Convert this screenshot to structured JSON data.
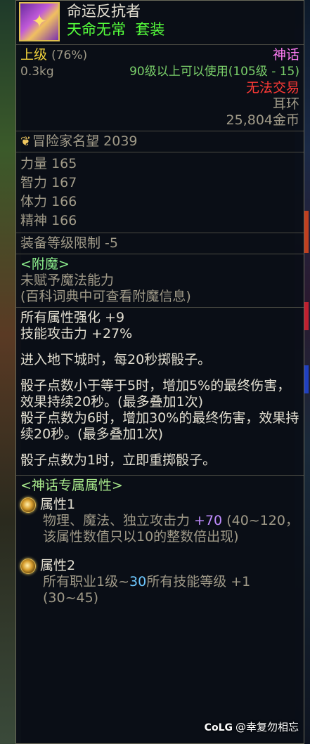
{
  "item": {
    "icon_name": "mythic-earring-icon",
    "name": "命运反抗者",
    "set_name": "天命无常",
    "set_label": "套装",
    "grade": "上级",
    "grade_pct": "(76%)",
    "rarity": "神话",
    "weight": "0.3kg",
    "level_req": "90级以上可以使用(105级 - 15)",
    "trade": "无法交易",
    "slot": "耳环",
    "price": "25,804金币"
  },
  "fame": {
    "icon_name": "laurel-icon",
    "label": "冒险家名望",
    "value": "2039"
  },
  "stats": [
    {
      "label": "力量",
      "value": "165"
    },
    {
      "label": "智力",
      "value": "167"
    },
    {
      "label": "体力",
      "value": "166"
    },
    {
      "label": "精神",
      "value": "166"
    }
  ],
  "equip_limit": "装备等级限制 -5",
  "enchant": {
    "title": "<附魔>",
    "line1": "未赋予魔法能力",
    "line2": "(百科词典中可查看附魔信息)"
  },
  "bonus": {
    "line1": "所有属性强化 +9",
    "line2": "技能攻击力 +27%"
  },
  "effect": {
    "p1": "进入地下城时，每20秒掷骰子。",
    "p2": "骰子点数小于等于5时，增加5%的最终伤害，效果持续20秒。(最多叠加1次)",
    "p3": "骰子点数为6时，增加30%的最终伤害，效果持续20秒。(最多叠加1次)",
    "p4": "骰子点数为1时，立即重掷骰子。"
  },
  "mythic": {
    "title": "<神话专属属性>",
    "attr1_label": "属性1",
    "attr1_pre": "物理、魔法、独立攻击力 ",
    "attr1_val": "+70",
    "attr1_post": " (40~120，该属性数值只以10的整数倍出现)",
    "attr2_label": "属性2",
    "attr2_pre": "所有职业1级~",
    "attr2_val": "30",
    "attr2_post": "所有技能等级 +1 (30~45)"
  },
  "watermark": {
    "logo": "CoLG",
    "text": "@幸复勿相忘"
  },
  "colors": {
    "green": "#55ff3c",
    "mythic_pink": "#ff7cf4",
    "untradeable_red": "#ff3a36",
    "grade_yellow": "#f0d23c"
  }
}
